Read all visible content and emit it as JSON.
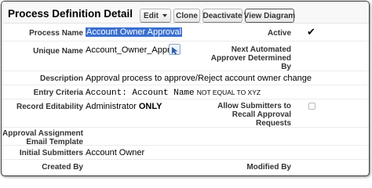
{
  "header": {
    "title": "Process Definition Detail",
    "buttons": {
      "edit": "Edit",
      "clone": "Clone",
      "deactivate": "Deactivate",
      "view_diagram": "View Diagram"
    }
  },
  "fields": {
    "process_name": {
      "label": "Process Name",
      "value": "Account Owner Approval"
    },
    "active": {
      "label": "Active",
      "checked": true
    },
    "unique_name": {
      "label": "Unique Name",
      "value": "Account_Owner_Approval"
    },
    "next_approver": {
      "label_1": "Next Automated",
      "label_2": "Approver Determined",
      "label_3": "By"
    },
    "description": {
      "label": "Description",
      "value": "Approval process to approve/Reject account owner change"
    },
    "entry_criteria": {
      "label": "Entry Criteria",
      "value_main": "Account: Account Name",
      "value_suffix": "NOT EQUAL TO XYZ"
    },
    "record_editability": {
      "label": "Record Editability",
      "value_main": "Administrator",
      "value_bold": "ONLY"
    },
    "allow_recall": {
      "label_1": "Allow Submitters to",
      "label_2": "Recall Approval",
      "label_3": "Requests",
      "checked": false
    },
    "email_template": {
      "label_1": "Approval Assignment",
      "label_2": "Email Template"
    },
    "initial_submitters": {
      "label": "Initial Submitters",
      "value": "Account Owner"
    },
    "created_by": {
      "label": "Created By"
    },
    "modified_by": {
      "label": "Modified By"
    }
  },
  "icons": {
    "active_check": "checkmark-icon",
    "cursor": "mouse-pointer-icon"
  }
}
